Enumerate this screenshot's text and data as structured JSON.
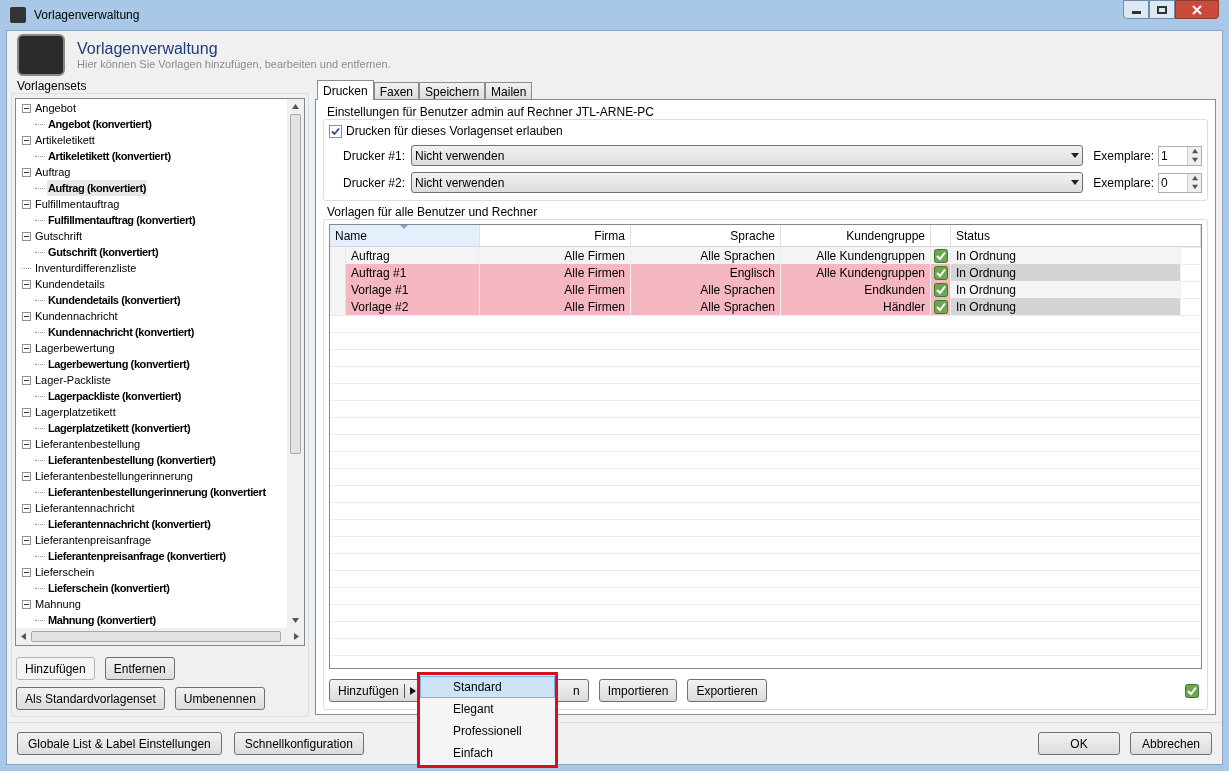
{
  "window": {
    "title": "Vorlagenverwaltung"
  },
  "header": {
    "title": "Vorlagenverwaltung",
    "subtitle": "Hier können Sie Vorlagen hinzufügen, bearbeiten und entfernen."
  },
  "template_sets": {
    "label": "Vorlagensets",
    "tree": [
      {
        "label": "Angebot",
        "selected": false,
        "children": [
          {
            "label": "Angebot (konvertiert)",
            "selected": false
          }
        ]
      },
      {
        "label": "Artikeletikett",
        "selected": false,
        "children": [
          {
            "label": "Artikeletikett (konvertiert)",
            "selected": false
          }
        ]
      },
      {
        "label": "Auftrag",
        "selected": false,
        "children": [
          {
            "label": "Auftrag (konvertiert)",
            "selected": true
          }
        ]
      },
      {
        "label": "Fulfillmentauftrag",
        "selected": false,
        "children": [
          {
            "label": "Fulfillmentauftrag (konvertiert)",
            "selected": false
          }
        ]
      },
      {
        "label": "Gutschrift",
        "selected": false,
        "children": [
          {
            "label": "Gutschrift (konvertiert)",
            "selected": false
          }
        ]
      },
      {
        "label": "Inventurdifferenzliste",
        "selected": false
      },
      {
        "label": "Kundendetails",
        "selected": false,
        "children": [
          {
            "label": "Kundendetails (konvertiert)",
            "selected": false
          }
        ]
      },
      {
        "label": "Kundennachricht",
        "selected": false,
        "children": [
          {
            "label": "Kundennachricht (konvertiert)",
            "selected": false
          }
        ]
      },
      {
        "label": "Lagerbewertung",
        "selected": false,
        "children": [
          {
            "label": "Lagerbewertung (konvertiert)",
            "selected": false
          }
        ]
      },
      {
        "label": "Lager-Packliste",
        "selected": false,
        "children": [
          {
            "label": "Lagerpackliste (konvertiert)",
            "selected": false
          }
        ]
      },
      {
        "label": "Lagerplatzetikett",
        "selected": false,
        "children": [
          {
            "label": "Lagerplatzetikett (konvertiert)",
            "selected": false
          }
        ]
      },
      {
        "label": "Lieferantenbestellung",
        "selected": false,
        "children": [
          {
            "label": "Lieferantenbestellung (konvertiert)",
            "selected": false
          }
        ]
      },
      {
        "label": "Lieferantenbestellungerinnerung",
        "selected": false,
        "children": [
          {
            "label": "Lieferantenbestellungerinnerung (konvertiert",
            "selected": false
          }
        ]
      },
      {
        "label": "Lieferantennachricht",
        "selected": false,
        "children": [
          {
            "label": "Lieferantennachricht (konvertiert)",
            "selected": false
          }
        ]
      },
      {
        "label": "Lieferantenpreisanfrage",
        "selected": false,
        "children": [
          {
            "label": "Lieferantenpreisanfrage (konvertiert)",
            "selected": false
          }
        ]
      },
      {
        "label": "Lieferschein",
        "selected": false,
        "children": [
          {
            "label": "Lieferschein (konvertiert)",
            "selected": false
          }
        ]
      },
      {
        "label": "Mahnung",
        "selected": false,
        "children": [
          {
            "label": "Mahnung (konvertiert)",
            "selected": false
          }
        ]
      }
    ],
    "buttons": [
      {
        "label": "Hinzufügen",
        "disabled": true
      },
      {
        "label": "Entfernen",
        "disabled": false
      },
      {
        "label": "Als Standardvorlagenset",
        "disabled": false
      },
      {
        "label": "Umbenennen",
        "disabled": false
      }
    ]
  },
  "tabs": [
    {
      "label": "Drucken",
      "selected": true
    },
    {
      "label": "Faxen",
      "selected": false
    },
    {
      "label": "Speichern",
      "selected": false
    },
    {
      "label": "Mailen",
      "selected": false
    }
  ],
  "print_settings": {
    "label": "Einstellungen für Benutzer admin auf Rechner JTL-ARNE-PC",
    "allow": {
      "label": "Drucken für dieses Vorlagenset erlauben",
      "checked": true
    },
    "printers": [
      {
        "label": "Drucker #1:",
        "value": "Nicht verwenden",
        "copies_label": "Exemplare:",
        "copies": "1"
      },
      {
        "label": "Drucker #2:",
        "value": "Nicht verwenden",
        "copies_label": "Exemplare:",
        "copies": "0"
      }
    ]
  },
  "templates": {
    "label": "Vorlagen für alle Benutzer und Rechner",
    "columns": [
      "Name",
      "Firma",
      "Sprache",
      "Kundengruppe",
      "Status"
    ],
    "rows": [
      {
        "cells": [
          "Auftrag",
          "Alle Firmen",
          "Alle Sprachen",
          "Alle Kundengruppen",
          "In Ordnung"
        ],
        "highlighted": false,
        "valid": true
      },
      {
        "cells": [
          "Auftrag #1",
          "Alle Firmen",
          "Englisch",
          "Alle Kundengruppen",
          "In Ordnung"
        ],
        "highlighted": true,
        "valid": true
      },
      {
        "cells": [
          "Vorlage #1",
          "Alle Firmen",
          "Alle Sprachen",
          "Endkunden",
          "In Ordnung"
        ],
        "highlighted": true,
        "valid": true
      },
      {
        "cells": [
          "Vorlage #2",
          "Alle Firmen",
          "Alle Sprachen",
          "Händler",
          "In Ordnung"
        ],
        "highlighted": true,
        "valid": true
      }
    ]
  },
  "actions": {
    "add": "Hinzufügen",
    "hidden_button": "n",
    "buttons": [
      "Importieren",
      "Exportieren"
    ],
    "add_menu": [
      {
        "label": "Standard",
        "selected": true
      },
      {
        "label": "Elegant",
        "selected": false
      },
      {
        "label": "Professionell",
        "selected": false
      },
      {
        "label": "Einfach",
        "selected": false
      }
    ]
  },
  "footer": {
    "left": [
      "Globale List & Label Einstellungen",
      "Schnellkonfiguration"
    ],
    "right": [
      "OK",
      "Abbrechen"
    ]
  }
}
